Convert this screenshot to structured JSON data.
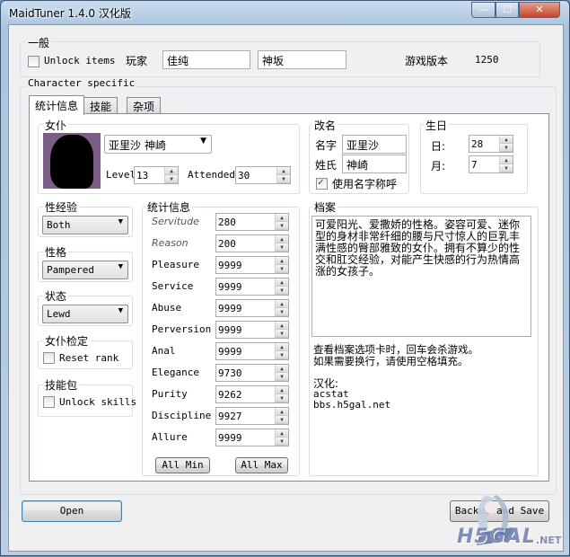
{
  "window": {
    "title": "MaidTuner 1.4.0 汉化版",
    "min_glyph": "—",
    "max_glyph": "☐",
    "close_glyph": "✕"
  },
  "general": {
    "legend": "一般",
    "unlock_items_label": "Unlock items",
    "player_label": "玩家",
    "player_first": "佳纯",
    "player_last": "神坂",
    "game_version_label": "游戏版本",
    "game_version": "1250"
  },
  "character_specific_label": "Character specific",
  "tabs": [
    {
      "label": "统计信息",
      "active": true
    },
    {
      "label": "技能"
    },
    {
      "label": "杂项"
    }
  ],
  "maid": {
    "legend": "女仆",
    "selected": "亚里沙 神崎",
    "level_label": "Level",
    "level": "13",
    "attended_label": "Attended",
    "attended": "30"
  },
  "rename": {
    "legend": "改名",
    "first_label": "名字",
    "first_value": "亚里沙",
    "last_label": "姓氏",
    "last_value": "神崎",
    "use_nickname_label": "使用名字称呼",
    "use_nickname": true
  },
  "birthday": {
    "legend": "生日",
    "day_label": "日:",
    "day": "28",
    "month_label": "月:",
    "month": "7"
  },
  "sex_experience": {
    "legend": "性经验",
    "value": "Both"
  },
  "personality": {
    "legend": "性格",
    "value": "Pampered"
  },
  "condition": {
    "legend": "状态",
    "value": "Lewd"
  },
  "maid_check": {
    "legend": "女仆检定",
    "reset_rank_label": "Reset rank"
  },
  "skill_pack": {
    "legend": "技能包",
    "unlock_skills_label": "Unlock skills"
  },
  "stats": {
    "legend": "统计信息",
    "rows": [
      {
        "label": "Servitude",
        "value": "280",
        "italic": true
      },
      {
        "label": "Reason",
        "value": "200",
        "italic": true
      },
      {
        "label": "Pleasure",
        "value": "9999"
      },
      {
        "label": "Service",
        "value": "9999"
      },
      {
        "label": "Abuse",
        "value": "9999"
      },
      {
        "label": "Perversion",
        "value": "9999"
      },
      {
        "label": "Anal",
        "value": "9999"
      },
      {
        "label": "Elegance",
        "value": "9730"
      },
      {
        "label": "Purity",
        "value": "9262"
      },
      {
        "label": "Discipline",
        "value": "9927"
      },
      {
        "label": "Allure",
        "value": "9999"
      }
    ],
    "all_min_label": "All Min",
    "all_max_label": "All Max"
  },
  "profile": {
    "legend": "档案",
    "text": "可爱阳光、爱撒娇的性格。姿容可爱、迷你型的身材非常纤细的腰与尺寸惊人的巨乳丰满性感的臀部雅致的女仆。拥有不算少的性交和肛交经验，对能产生快感的行为热情高涨的女孩子。",
    "note1": "查看档案选项卡时，回车会杀游戏。",
    "note2": "如果需要换行，请使用空格填充。",
    "credit_title": "汉化:",
    "credit1": "acstat",
    "credit2": "bbs.h5gal.net"
  },
  "buttons": {
    "open": "Open",
    "backup_save": "Backup and Save"
  },
  "watermark": {
    "text": "H5GAL",
    "suffix": ".NET"
  }
}
